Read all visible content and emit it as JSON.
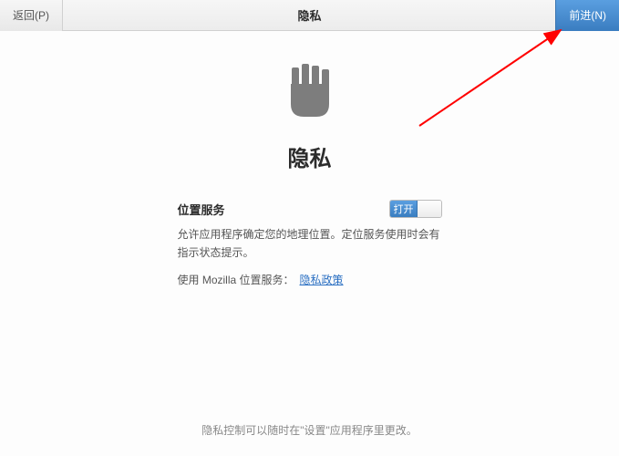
{
  "header": {
    "back_label": "返回(P)",
    "title": "隐私",
    "forward_label": "前进(N)"
  },
  "main": {
    "page_title": "隐私",
    "section_label": "位置服务",
    "toggle_on_label": "打开",
    "description": "允许应用程序确定您的地理位置。定位服务使用时会有指示状态提示。",
    "mozilla_text": "使用 Mozilla 位置服务：",
    "link_text": "隐私政策"
  },
  "footer": {
    "text": "隐私控制可以随时在\"设置\"应用程序里更改。"
  }
}
